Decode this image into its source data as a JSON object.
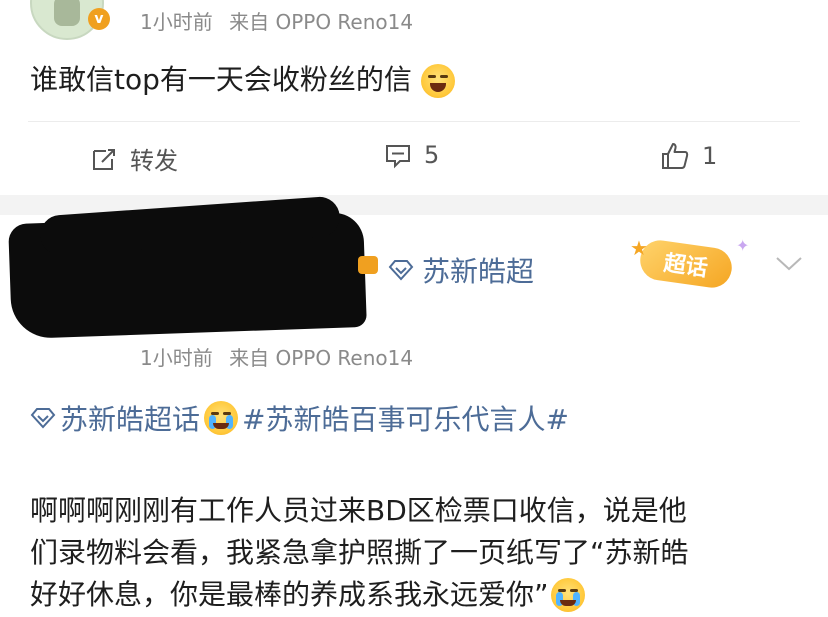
{
  "post1": {
    "meta_time": "1小时前",
    "meta_source": "来自 OPPO Reno14",
    "text": "谁敢信top有一天会收粉丝的信",
    "emoji": "laugh-cry-emoji"
  },
  "actions": {
    "repost_label": "转发",
    "comment_count": "5",
    "like_count": "1"
  },
  "post2": {
    "topic_tag": "苏新皓超",
    "badge_text": "超话",
    "meta_time": "1小时前",
    "meta_source": "来自 OPPO Reno14",
    "topic_link": "苏新皓超话",
    "hashtag": "#苏新皓百事可乐代言人#",
    "body_lines": [
      "啊啊啊刚刚有工作人员过来BD区检票口收信，说是他",
      "们录物料会看，我紧急拿护照撕了一页纸写了“苏新皓",
      "好好休息，你是最棒的养成系我永远爱你”"
    ]
  },
  "colors": {
    "link_blue": "#4d6c97",
    "meta_gray": "#8a8a8a",
    "badge_orange": "#f5a623"
  }
}
